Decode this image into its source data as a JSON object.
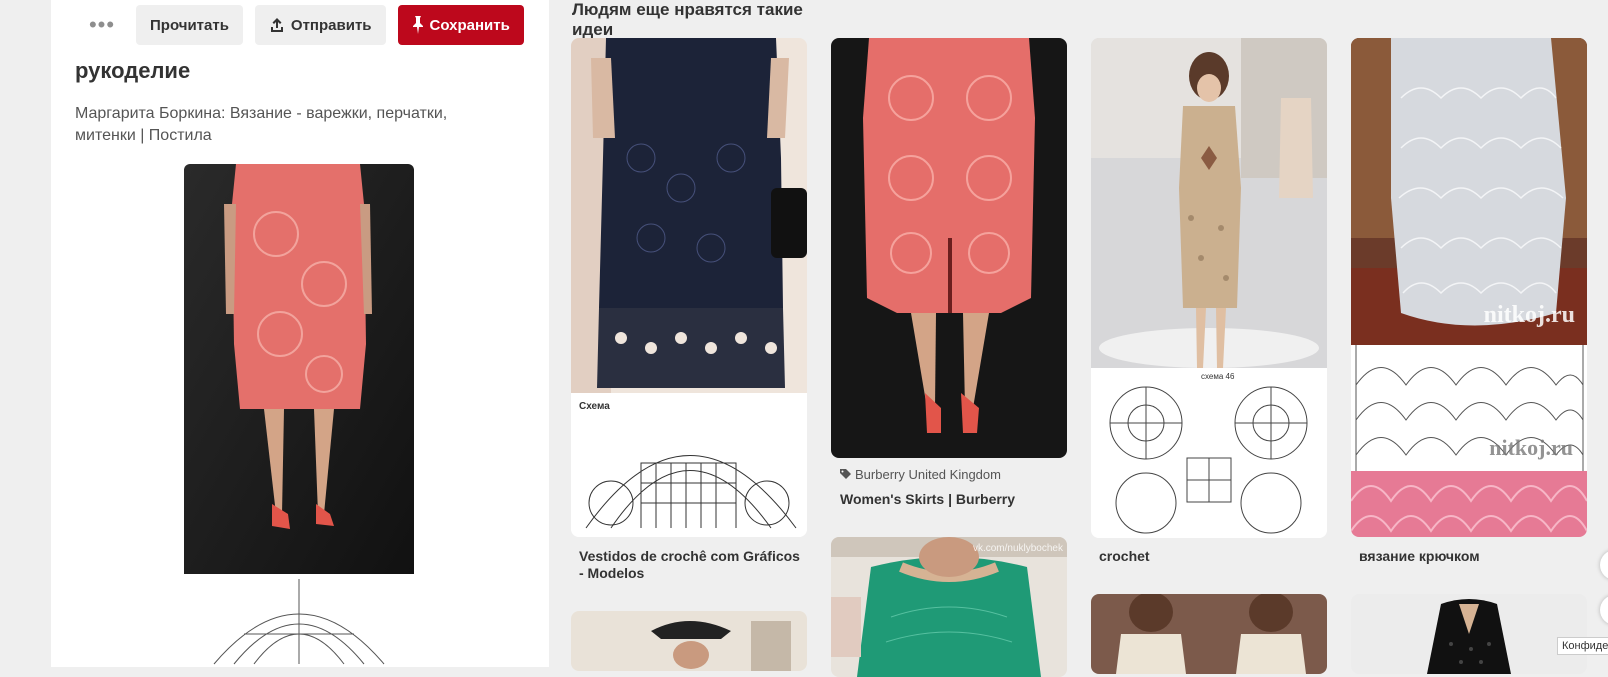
{
  "toolbar": {
    "more_icon": "more-dots-icon",
    "read_label": "Прочитать",
    "send_label": "Отправить",
    "send_icon": "share-upload-icon",
    "save_label": "Сохранить",
    "save_icon": "pin-icon",
    "save_color": "#bd081c"
  },
  "pin": {
    "board_title": "рукоделие",
    "description": "Маргарита Боркина: Вязание - варежки, перчатки, митенки | Постила"
  },
  "related": {
    "heading": "Людям еще нравятся такие идеи",
    "pins": [
      {
        "label": "Vestidos de crochê com Gráficos - Modelos",
        "chart_caption": "Схема"
      },
      {
        "source": "Burberry United Kingdom",
        "label": "Women's Skirts | Burberry"
      },
      {
        "label": "crochet",
        "chart_caption": "схема 46"
      },
      {
        "label": "вязание крючком",
        "watermark_1": "nitkoj.ru",
        "watermark_2": "nitkoj.ru"
      },
      {
        "watermark": "vk.com/nuklybochek"
      }
    ]
  },
  "privacy_label": "Конфиде"
}
